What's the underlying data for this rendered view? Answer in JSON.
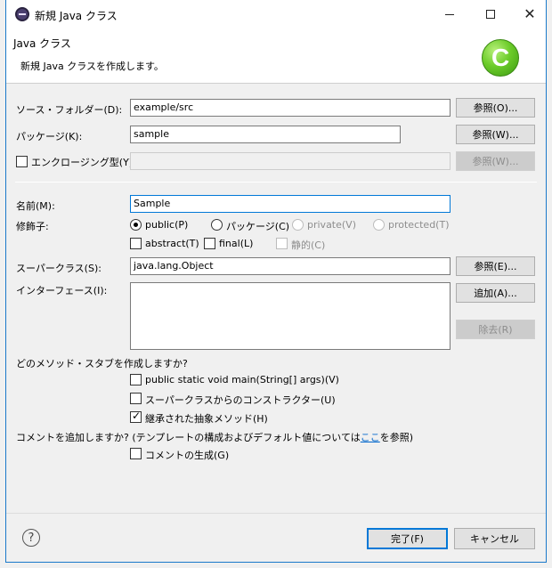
{
  "window": {
    "title": "新規 Java クラス",
    "minimize_icon": "minimize-icon",
    "maximize_icon": "maximize-icon",
    "close_glyph": "✕"
  },
  "banner": {
    "title": "Java クラス",
    "description": "新規 Java クラスを作成します。",
    "icon": "java-class-wizard-icon"
  },
  "source_folder": {
    "label": "ソース・フォルダー(D):",
    "value": "example/src",
    "browse": "参照(O)..."
  },
  "package": {
    "label": "パッケージ(K):",
    "value": "sample",
    "browse": "参照(W)..."
  },
  "enclosing": {
    "label": "エンクロージング型(Y):",
    "value": "",
    "browse": "参照(W)...",
    "checked": false
  },
  "name": {
    "label": "名前(M):",
    "value": "Sample"
  },
  "modifiers": {
    "label": "修飾子:",
    "public": "public(P)",
    "package": "パッケージ(C)",
    "private": "private(V)",
    "protected": "protected(T)",
    "abstract": "abstract(T)",
    "final": "final(L)",
    "static": "静的(C)",
    "selected": "public"
  },
  "superclass": {
    "label": "スーパークラス(S):",
    "value": "java.lang.Object",
    "browse": "参照(E)..."
  },
  "interfaces": {
    "label": "インターフェース(I):",
    "add": "追加(A)...",
    "remove": "除去(R)"
  },
  "stubs": {
    "question": "どのメソッド・スタブを作成しますか?",
    "main": "public static void main(String[] args)(V)",
    "constructors": "スーパークラスからのコンストラクター(U)",
    "inherited": "継承された抽象メソッド(H)"
  },
  "comments": {
    "question_prefix": "コメントを追加しますか? (テンプレートの構成およびデフォルト値については",
    "link": "ここ",
    "question_suffix": "を参照)",
    "generate": "コメントの生成(G)"
  },
  "footer": {
    "help_glyph": "?",
    "finish": "完了(F)",
    "cancel": "キャンセル"
  }
}
